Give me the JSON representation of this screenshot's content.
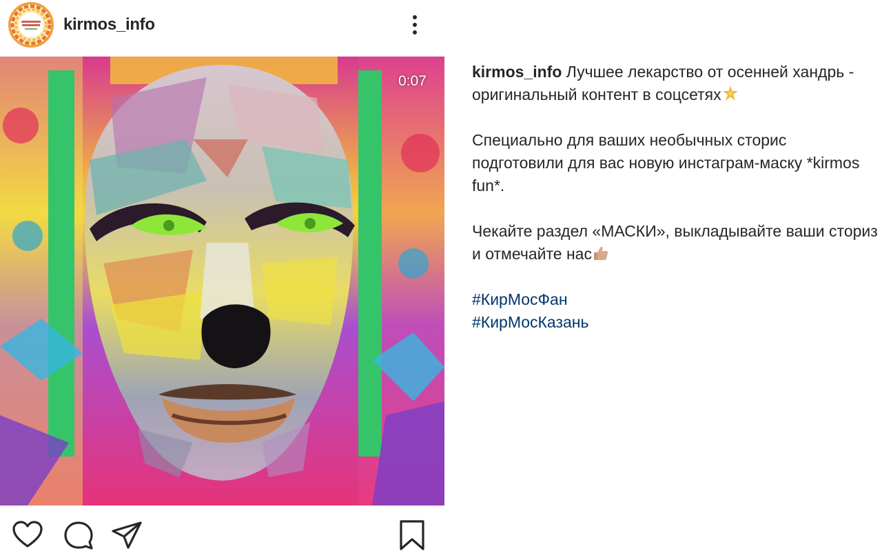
{
  "post": {
    "username": "kirmos_info",
    "avatar_icon": "kirmos-logo-wreath",
    "more_icon": "more-vertical-icon",
    "video_timer": "0:07"
  },
  "caption": {
    "username": "kirmos_info",
    "line1": "Лучшее лекарство от осенней хандрь - оригинальный контент в соцсетях",
    "line1_emoji": "sparkle-star",
    "para2": "Специально для ваших необычных сторис подготовили для вас новую инстаграм-маску *kirmos fun*.",
    "para3": "Чекайте раздел «МАСКИ», выкладывайте ваши сториз и отмечайте нас",
    "para3_emoji": "thumbs-up",
    "hashtags": [
      "#КирМосФан",
      "#КирМосКазань"
    ]
  },
  "actions": {
    "like_icon": "heart-icon",
    "comment_icon": "comment-icon",
    "share_icon": "send-icon",
    "save_icon": "bookmark-icon"
  },
  "colors": {
    "text": "#262626",
    "hashtag": "#00376b",
    "background": "#ffffff"
  }
}
